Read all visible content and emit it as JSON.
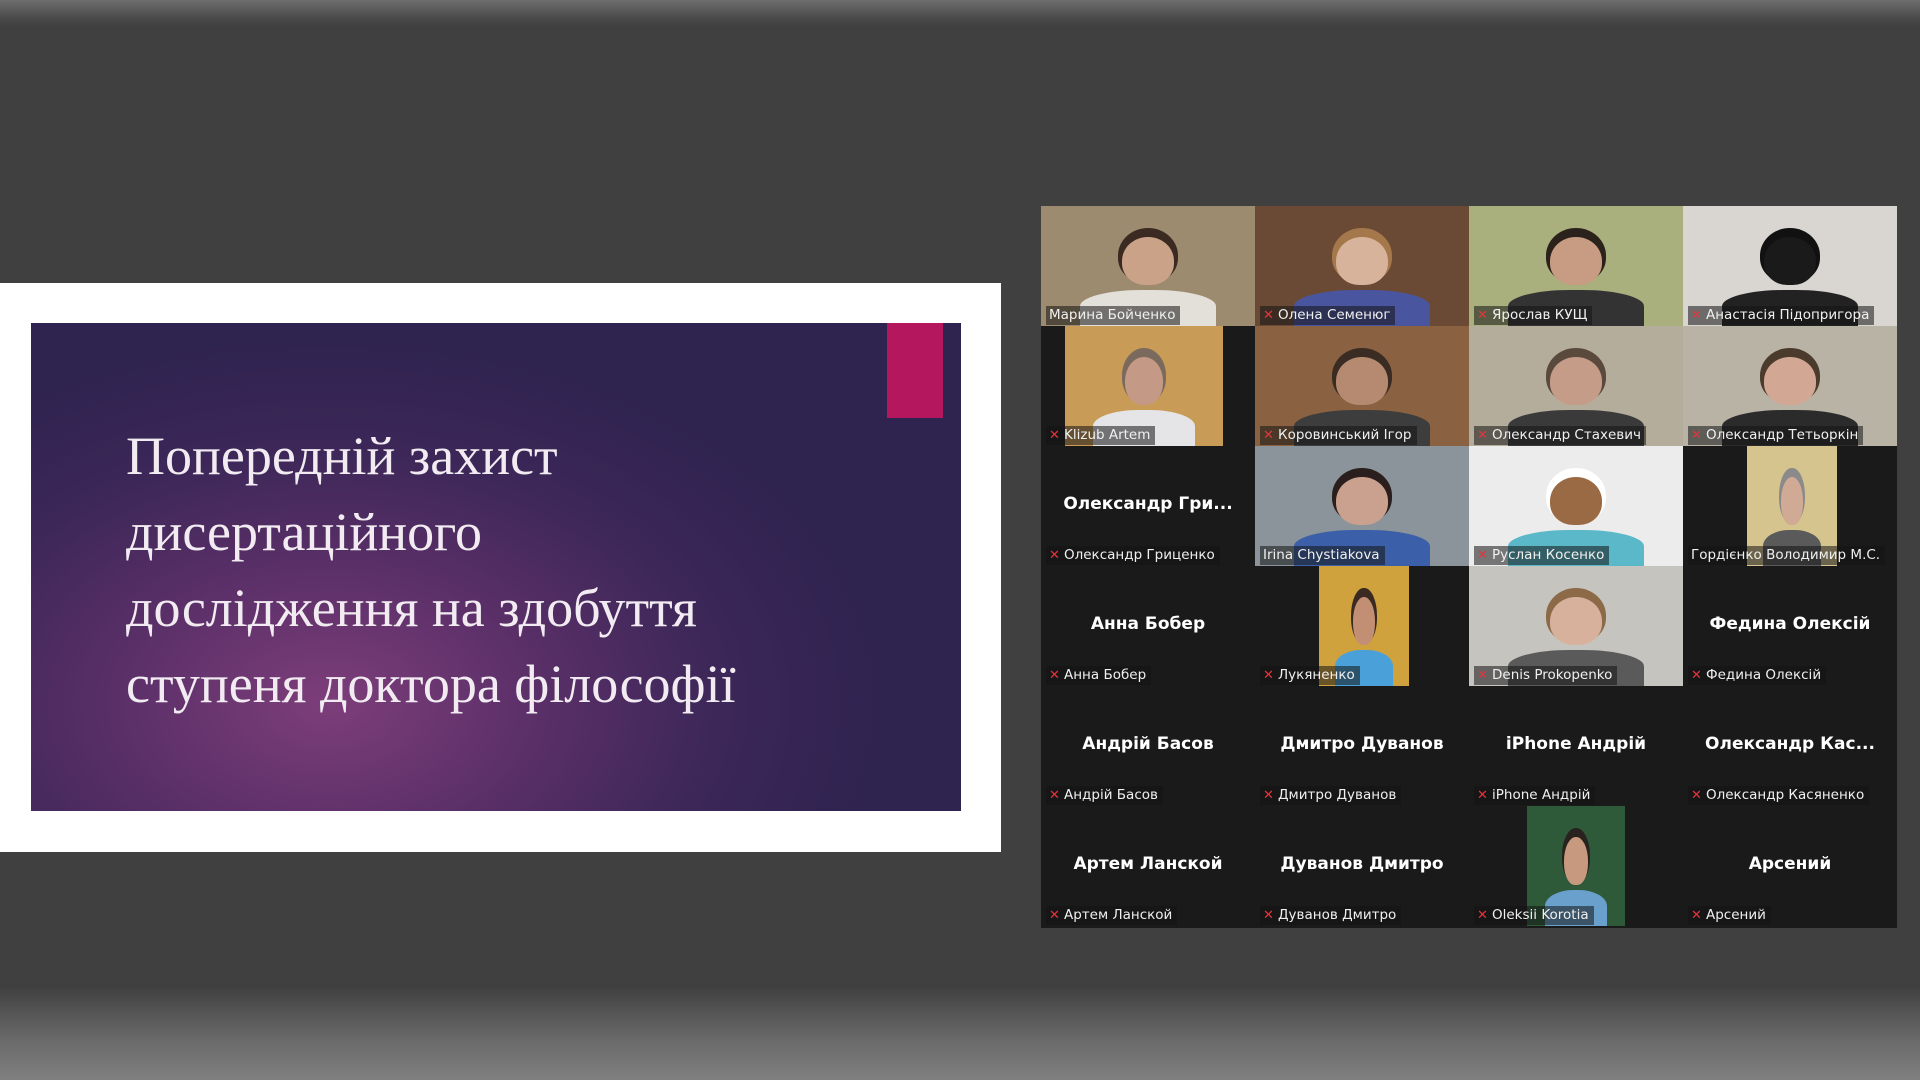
{
  "slide": {
    "title": "Попередній захист\nдисертаційного\nдослідження на здобуття\nступеня доктора філософії"
  },
  "gallery": {
    "participants": [
      {
        "tag": "Марина Бойченко",
        "muted": false,
        "active": true,
        "video": "full",
        "bg": "#9c8b6e",
        "skin": "#c9a288",
        "hair": "#3a2a22",
        "shirt": "#e3e0da"
      },
      {
        "tag": "Олена Семенюг",
        "muted": true,
        "video": "full",
        "bg": "#6b4a35",
        "skin": "#d6b39a",
        "hair": "#a4784a",
        "shirt": "#4a55a0"
      },
      {
        "tag": "Ярослав КУЩ",
        "muted": true,
        "video": "full",
        "bg": "#a9b07d",
        "skin": "#c79c82",
        "hair": "#2b221c",
        "shirt": "#333333"
      },
      {
        "tag": "Анастасія Підопригора",
        "muted": true,
        "video": "full",
        "bg": "#d9d6d2",
        "skin": "#1a1a1a",
        "hair": "#111111",
        "shirt": "#222222"
      },
      {
        "tag": "Klizub Artem",
        "muted": true,
        "video": "left",
        "bg": "#c89b57",
        "skin": "#c49a86",
        "hair": "#7a6a5e",
        "shirt": "#e5e5e8"
      },
      {
        "tag": "Коровинський Ігор",
        "muted": true,
        "video": "full",
        "bg": "#8a6242",
        "skin": "#b58a70",
        "hair": "#3a2c22",
        "shirt": "#3d3d3d"
      },
      {
        "tag": "Олександр Стахевич",
        "muted": true,
        "video": "full",
        "bg": "#b5ad9c",
        "skin": "#c59c88",
        "hair": "#5a4a3e",
        "shirt": "#3a3a3a"
      },
      {
        "tag": "Олександр Тетьоркін",
        "muted": true,
        "video": "full",
        "bg": "#b9b3a6",
        "skin": "#d2a895",
        "hair": "#4b3b2c",
        "shirt": "#2b2b2b"
      },
      {
        "display": "Олександр  Гри...",
        "tag": "Олександр Гриценко",
        "muted": true,
        "video": "none"
      },
      {
        "tag": "Irina Chystiakova",
        "muted": false,
        "video": "full",
        "bg": "#8b949b",
        "skin": "#caa08e",
        "hair": "#2a1f1c",
        "shirt": "#3b5fa8"
      },
      {
        "tag": "Руслан Косенко",
        "muted": true,
        "video": "full",
        "bg": "#ececec",
        "skin": "#9a6a44",
        "hair": "#ffffff",
        "shirt": "#5ab8c8"
      },
      {
        "tag": "Гордієнко Володимир М.С.",
        "muted": false,
        "video": "center",
        "bg": "#d6c48f",
        "skin": "#d0aa94",
        "hair": "#8a8a8a",
        "shirt": "#5a5a5a"
      },
      {
        "display": "Анна Бобер",
        "tag": "Анна Бобер",
        "muted": true,
        "video": "none"
      },
      {
        "tag": "Лукяненко",
        "muted": true,
        "video": "center",
        "bg": "#d0a23e",
        "skin": "#c28e74",
        "hair": "#3a2a22",
        "shirt": "#4aa0d8"
      },
      {
        "tag": "Denis Prokopenko",
        "muted": true,
        "video": "full",
        "bg": "#c6c4be",
        "skin": "#d8b19c",
        "hair": "#8c6a48",
        "shirt": "#5a5a5a"
      },
      {
        "display": "Федина Олексій",
        "tag": "Федина Олексій",
        "muted": true,
        "video": "none"
      },
      {
        "display": "Андрій Басов",
        "tag": "Андрій Басов",
        "muted": true,
        "video": "none"
      },
      {
        "display": "Дмитро Дуванов",
        "tag": "Дмитро Дуванов",
        "muted": true,
        "video": "none"
      },
      {
        "display": "iPhone Андрій",
        "tag": "iPhone Андрій",
        "muted": true,
        "video": "none"
      },
      {
        "display": "Олександр  Кас...",
        "tag": "Олександр Касяненко",
        "muted": true,
        "video": "none"
      },
      {
        "display": "Артем Ланской",
        "tag": "Артем Ланской",
        "muted": true,
        "video": "none"
      },
      {
        "display": "Дуванов Дмитро",
        "tag": "Дуванов Дмитро",
        "muted": true,
        "video": "none"
      },
      {
        "tag": "Oleksii Korotia",
        "muted": true,
        "video": "center2",
        "bg": "#2e5a3a",
        "skin": "#c79a80",
        "hair": "#2a221e",
        "shirt": "#6aa0cc"
      },
      {
        "display": "Арсений",
        "tag": "Арсений",
        "muted": true,
        "video": "none"
      }
    ]
  }
}
